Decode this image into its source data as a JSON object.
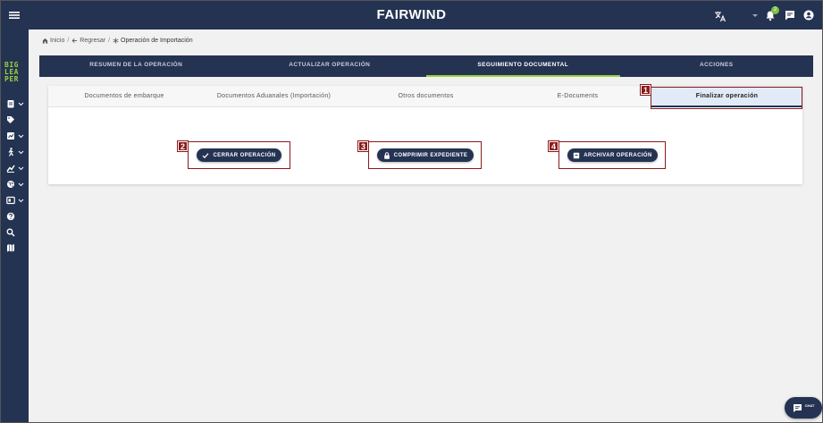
{
  "header": {
    "brand": "FAIRWIND",
    "notifications_count": "2"
  },
  "sidebar": {
    "logo_lines": [
      "BIG",
      "LEA",
      "PER"
    ],
    "items": [
      {
        "icon": "clipboard-icon",
        "has_caret": true
      },
      {
        "icon": "tag-icon",
        "has_caret": false
      },
      {
        "icon": "chart-icon",
        "has_caret": true
      },
      {
        "icon": "walk-icon",
        "has_caret": true
      },
      {
        "icon": "trend-icon",
        "has_caret": true
      },
      {
        "icon": "globe-icon",
        "has_caret": true
      },
      {
        "icon": "panel-icon",
        "has_caret": true
      },
      {
        "icon": "help-icon",
        "has_caret": false
      },
      {
        "icon": "search-icon",
        "has_caret": false
      },
      {
        "icon": "map-icon",
        "has_caret": false
      }
    ]
  },
  "breadcrumb": {
    "home": "Inicio",
    "back": "Regresar",
    "current": "Operación de Importación"
  },
  "main_tabs": [
    {
      "label": "RESUMEN DE LA OPERACIÓN",
      "active": false
    },
    {
      "label": "ACTUALIZAR OPERACIÓN",
      "active": false
    },
    {
      "label": "SEGUIMIENTO DOCUMENTAL",
      "active": true
    },
    {
      "label": "ACCIONES",
      "active": false
    }
  ],
  "sub_tabs": [
    {
      "label": "Documentos de embarque",
      "active": false
    },
    {
      "label": "Documentos Aduanales (Importación)",
      "active": false
    },
    {
      "label": "Otros documentos",
      "active": false
    },
    {
      "label": "E-Documents",
      "active": false
    },
    {
      "label": "Finalizar operación",
      "active": true
    }
  ],
  "actions": {
    "close": "CERRAR OPERACIÓN",
    "compress": "COMPRIMIR EXPEDIENTE",
    "archive": "ARCHIVAR OPERACIÓN"
  },
  "annotations": [
    "1",
    "2",
    "3",
    "4"
  ],
  "chat": {
    "label": "CHAT"
  },
  "colors": {
    "navy": "#243352",
    "accent_green": "#9bd13f",
    "annotation_red": "#8b1a1a"
  }
}
